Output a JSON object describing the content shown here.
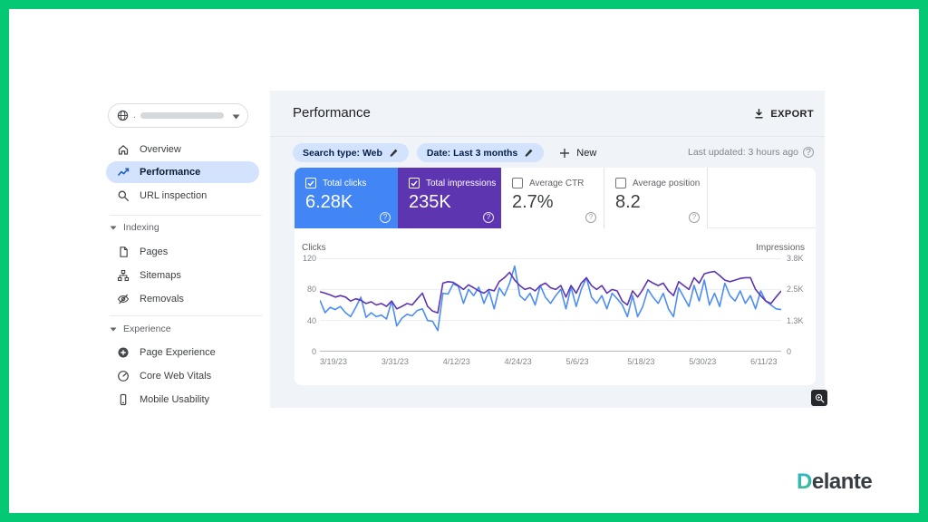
{
  "frame": {
    "border_color": "#05c874"
  },
  "watermark": {
    "brand": "Delante"
  },
  "property_selector": {
    "visible_text": ".",
    "redacted": true
  },
  "sidebar": {
    "items": [
      {
        "label": "Overview",
        "selected": false
      },
      {
        "label": "Performance",
        "selected": true
      },
      {
        "label": "URL inspection",
        "selected": false
      }
    ],
    "sections": [
      {
        "title": "Indexing",
        "items": [
          {
            "label": "Pages"
          },
          {
            "label": "Sitemaps"
          },
          {
            "label": "Removals"
          }
        ]
      },
      {
        "title": "Experience",
        "items": [
          {
            "label": "Page Experience"
          },
          {
            "label": "Core Web Vitals"
          },
          {
            "label": "Mobile Usability"
          }
        ]
      }
    ]
  },
  "header": {
    "title": "Performance",
    "export_label": "EXPORT",
    "last_updated": "Last updated: 3 hours ago"
  },
  "filters": {
    "chips": [
      {
        "label": "Search type: Web"
      },
      {
        "label": "Date: Last 3 months"
      }
    ],
    "new_label": "New"
  },
  "metrics": {
    "tiles": [
      {
        "label": "Total clicks",
        "value": "6.28K",
        "selected": true,
        "bg": "#4285f4"
      },
      {
        "label": "Total impressions",
        "value": "235K",
        "selected": true,
        "bg": "#5e35b1"
      },
      {
        "label": "Average CTR",
        "value": "2.7%",
        "selected": false,
        "bg": "#ffffff"
      },
      {
        "label": "Average position",
        "value": "8.2",
        "selected": false,
        "bg": "#ffffff"
      }
    ]
  },
  "chart_data": {
    "type": "line",
    "x_start": "3/19/23",
    "x_end": "6/17/23",
    "x_interval": "daily",
    "x_tick_labels": [
      "3/19/23",
      "3/31/23",
      "4/12/23",
      "4/24/23",
      "5/6/23",
      "5/18/23",
      "5/30/23",
      "6/11/23"
    ],
    "x_tick_indices": [
      0,
      12,
      24,
      36,
      48,
      60,
      72,
      84
    ],
    "left_axis": {
      "title": "Clicks",
      "ticks": [
        "120",
        "80",
        "40",
        "0"
      ],
      "max": 120
    },
    "right_axis": {
      "title": "Impressions",
      "ticks": [
        "3.8K",
        "2.5K",
        "1.3K",
        "0"
      ],
      "max": 3800
    },
    "grid": "horizontal",
    "legend_position": "none",
    "series": [
      {
        "name": "Clicks",
        "axis": "left",
        "color": "#4c8df6",
        "values": [
          66,
          50,
          57,
          54,
          58,
          50,
          45,
          57,
          70,
          44,
          50,
          45,
          47,
          42,
          65,
          33,
          43,
          48,
          46,
          53,
          55,
          40,
          39,
          27,
          75,
          74,
          87,
          84,
          62,
          80,
          72,
          83,
          62,
          78,
          55,
          82,
          72,
          88,
          110,
          72,
          66,
          75,
          60,
          85,
          70,
          62,
          72,
          80,
          55,
          83,
          58,
          80,
          95,
          70,
          62,
          72,
          55,
          75,
          68,
          60,
          45,
          72,
          45,
          58,
          80,
          70,
          62,
          75,
          55,
          45,
          82,
          70,
          58,
          85,
          65,
          92,
          60,
          75,
          58,
          88,
          72,
          65,
          78,
          62,
          72,
          55,
          78,
          65,
          60,
          55,
          54
        ]
      },
      {
        "name": "Impressions",
        "axis": "right",
        "color": "#5e35b1",
        "values": [
          2440,
          2380,
          2310,
          2220,
          2280,
          2220,
          2060,
          2150,
          2090,
          1960,
          2030,
          1900,
          1960,
          1840,
          2060,
          1740,
          1840,
          1960,
          1900,
          2150,
          2380,
          1840,
          1650,
          1580,
          2790,
          2850,
          2820,
          2690,
          2530,
          2720,
          2600,
          2470,
          2380,
          2530,
          2470,
          2850,
          3010,
          3230,
          2910,
          2690,
          2530,
          2600,
          2470,
          2690,
          2790,
          2600,
          2530,
          2690,
          2220,
          2690,
          2380,
          2790,
          3010,
          2690,
          2530,
          2690,
          2380,
          2530,
          2470,
          2060,
          1900,
          2470,
          2220,
          2530,
          2910,
          2790,
          2690,
          2790,
          2470,
          2280,
          2850,
          2690,
          2530,
          3010,
          2790,
          3170,
          3230,
          3260,
          3100,
          2910,
          2850,
          2910,
          2980,
          3010,
          3010,
          2530,
          2280,
          2060,
          1960,
          2220,
          2470
        ]
      }
    ]
  }
}
